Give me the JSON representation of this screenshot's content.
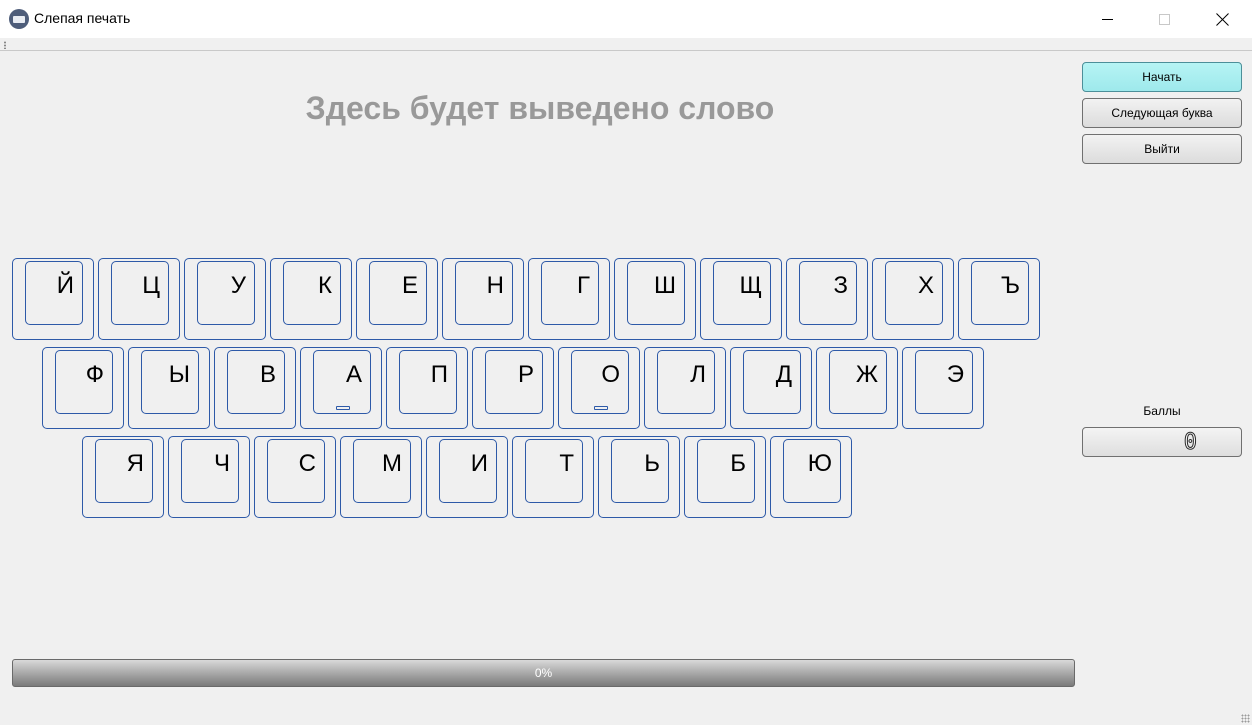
{
  "window": {
    "title": "Слепая печать",
    "icon": "keyboard-icon"
  },
  "word_display": "Здесь будет выведено слово",
  "keyboard": {
    "rows": [
      [
        "Й",
        "Ц",
        "У",
        "К",
        "Е",
        "Н",
        "Г",
        "Ш",
        "Щ",
        "З",
        "Х",
        "Ъ"
      ],
      [
        "Ф",
        "Ы",
        "В",
        "А",
        "П",
        "Р",
        "О",
        "Л",
        "Д",
        "Ж",
        "Э"
      ],
      [
        "Я",
        "Ч",
        "С",
        "М",
        "И",
        "Т",
        "Ь",
        "Б",
        "Ю"
      ]
    ],
    "home_keys": [
      "А",
      "О"
    ]
  },
  "buttons": {
    "start": "Начать",
    "next_letter": "Следующая буква",
    "exit": "Выйти"
  },
  "score": {
    "label": "Баллы",
    "value": "0"
  },
  "progress": {
    "value": 0,
    "text": "0%"
  },
  "colors": {
    "accent_button": "#a7eef0",
    "key_border": "#2e5aa8",
    "word_text": "#999999"
  }
}
